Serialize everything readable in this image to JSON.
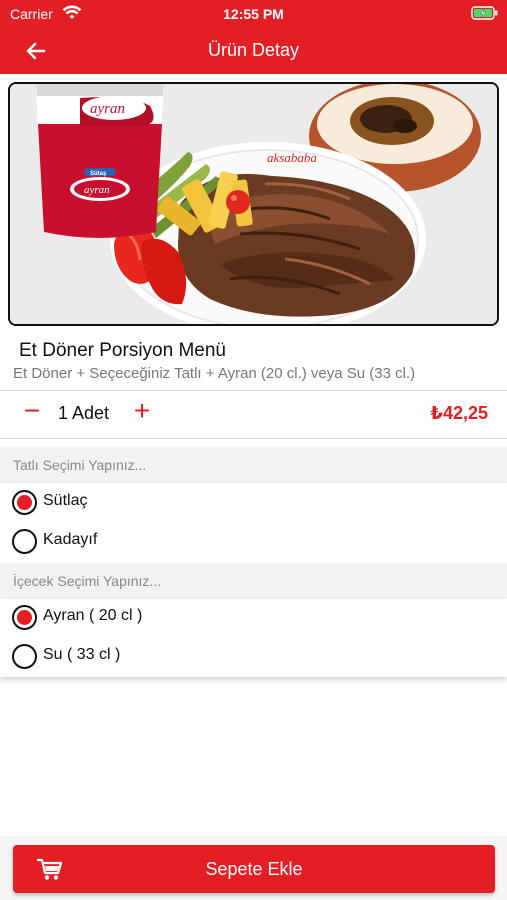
{
  "status_bar": {
    "carrier": "Carrier",
    "time": "12:55 PM"
  },
  "nav": {
    "title": "Ürün Detay",
    "back_icon": "arrow-left-icon"
  },
  "hero": {
    "cup_brand": "Sütaş",
    "cup_label": "ayran",
    "plate_brand": "aksababa"
  },
  "product": {
    "title": "Et Döner Porsiyon Menü",
    "description": "Et Döner + Seçeceğiniz Tatlı + Ayran (20 cl.) veya Su (33 cl.)"
  },
  "quantity": {
    "minus": "−",
    "value": "1 Adet",
    "plus": "+"
  },
  "price": "₺42,25",
  "dessert": {
    "header": "Tatlı Seçimi Yapınız...",
    "options": [
      {
        "label": "Sütlaç",
        "selected": true
      },
      {
        "label": "Kadayıf",
        "selected": false
      }
    ]
  },
  "drink": {
    "header": "İçecek Seçimi Yapınız...",
    "options": [
      {
        "label": "Ayran ( 20 cl )",
        "selected": true
      },
      {
        "label": "Su ( 33 cl )",
        "selected": false
      }
    ]
  },
  "cart_button": {
    "label": "Sepete Ekle",
    "icon": "cart-icon"
  },
  "colors": {
    "accent": "#e31e24",
    "muted_text": "#777777",
    "section_bg": "#f2f2f2"
  }
}
